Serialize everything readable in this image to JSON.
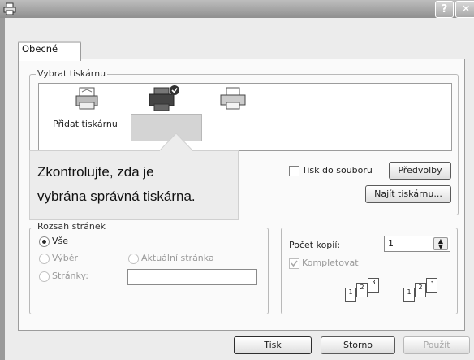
{
  "window": {
    "help_label": "?",
    "close_label": "✕",
    "icons": {
      "app": "printer-app-icon",
      "help": "help-icon",
      "close": "close-icon"
    }
  },
  "tabs": [
    {
      "label": "Obecné",
      "selected": true
    }
  ],
  "printer_group": {
    "legend": "Vybrat tiskárnu",
    "items": [
      {
        "label": "Přidat tiskárnu",
        "icon": "add-printer-icon"
      },
      {
        "label": "",
        "icon": "default-printer-icon",
        "selected": true
      },
      {
        "label": "",
        "icon": "printer-icon"
      }
    ],
    "print_to_file": {
      "label": "Tisk do souboru",
      "checked": false
    },
    "preferences_label": "Předvolby",
    "find_printer_label": "Najít tiskárnu..."
  },
  "callout": {
    "line1": "Zkontrolujte, zda je",
    "line2": "vybrána správná tiskárna."
  },
  "range_group": {
    "legend": "Rozsah stránek",
    "options": [
      {
        "label": "Vše",
        "selected": true,
        "enabled": true
      },
      {
        "label": "Výběr",
        "selected": false,
        "enabled": false
      },
      {
        "label": "Aktuální stránka",
        "selected": false,
        "enabled": false
      },
      {
        "label": "Stránky:",
        "selected": false,
        "enabled": false
      }
    ],
    "pages_value": ""
  },
  "copies_group": {
    "copies_label": "Počet kopií:",
    "copies_value": "1",
    "collate": {
      "label": "Kompletovat",
      "checked": true,
      "enabled": false
    },
    "collate_pages": [
      "1",
      "2",
      "3"
    ]
  },
  "buttons": {
    "print": "Tisk",
    "cancel": "Storno",
    "apply": "Použít"
  },
  "colors": {
    "titlebar": "#9e9e9e",
    "dialog_bg": "#ececec",
    "panel_bg": "#fafafa",
    "callout_bg": "#ececec"
  }
}
